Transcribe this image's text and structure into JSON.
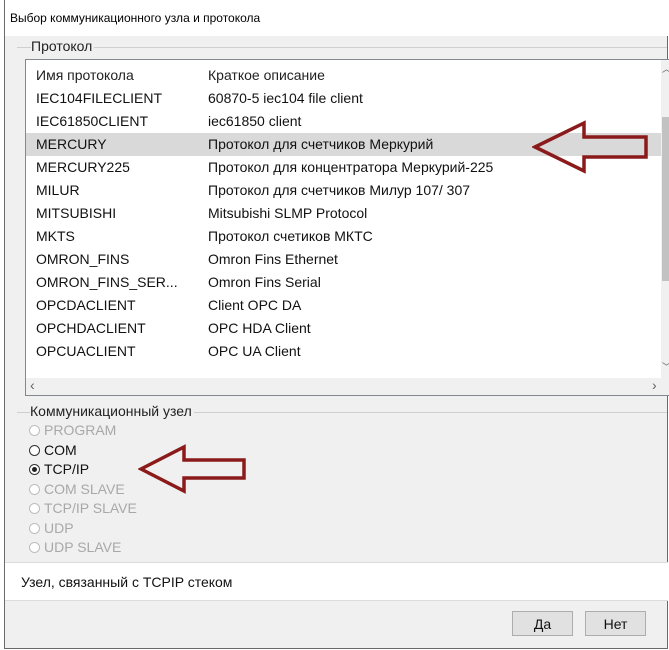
{
  "window": {
    "title": "Выбор коммуникационного узла и протокола"
  },
  "protocol_group": {
    "label": "Протокол",
    "columns": [
      "Имя протокола",
      "Краткое описание"
    ],
    "rows": [
      {
        "name": "IEC104FILECLIENT",
        "description": "60870-5 iec104 file client"
      },
      {
        "name": "IEC61850CLIENT",
        "description": "iec61850 client"
      },
      {
        "name": "MERCURY",
        "description": "Протокол для счетчиков Меркурий"
      },
      {
        "name": "MERCURY225",
        "description": "Протокол для концентратора Меркурий-225"
      },
      {
        "name": "MILUR",
        "description": "Протокол для счетчиков Милур 107/ 307"
      },
      {
        "name": "MITSUBISHI",
        "description": "Mitsubishi SLMP Protocol"
      },
      {
        "name": "MKTS",
        "description": "Протокол счетиков МКТС"
      },
      {
        "name": "OMRON_FINS",
        "description": "Omron Fins Ethernet"
      },
      {
        "name": "OMRON_FINS_SER...",
        "description": "Omron Fins Serial"
      },
      {
        "name": "OPCDACLIENT",
        "description": "Client OPC DA"
      },
      {
        "name": "OPCHDACLIENT",
        "description": "OPC HDA Client"
      },
      {
        "name": "OPCUACLIENT",
        "description": "OPC UA Client"
      }
    ],
    "selected_row": "MERCURY"
  },
  "node_group": {
    "label": "Коммуникационный узел",
    "options": [
      {
        "label": "PROGRAM",
        "enabled": false,
        "checked": false
      },
      {
        "label": "COM",
        "enabled": true,
        "checked": false
      },
      {
        "label": "TCP/IP",
        "enabled": true,
        "checked": true
      },
      {
        "label": "COM SLAVE",
        "enabled": false,
        "checked": false
      },
      {
        "label": "TCP/IP SLAVE",
        "enabled": false,
        "checked": false
      },
      {
        "label": "UDP",
        "enabled": false,
        "checked": false
      },
      {
        "label": "UDP SLAVE",
        "enabled": false,
        "checked": false
      }
    ]
  },
  "status": {
    "text": "Узел, связанный с TCPIP стеком"
  },
  "buttons": {
    "ok": "Да",
    "cancel": "Нет"
  },
  "colors": {
    "annotation_arrow": "#8b1a1a",
    "selection": "#d9d9d9"
  },
  "icons": {
    "left_arrow": "scroll-left-icon",
    "right_arrow": "scroll-right-icon"
  }
}
